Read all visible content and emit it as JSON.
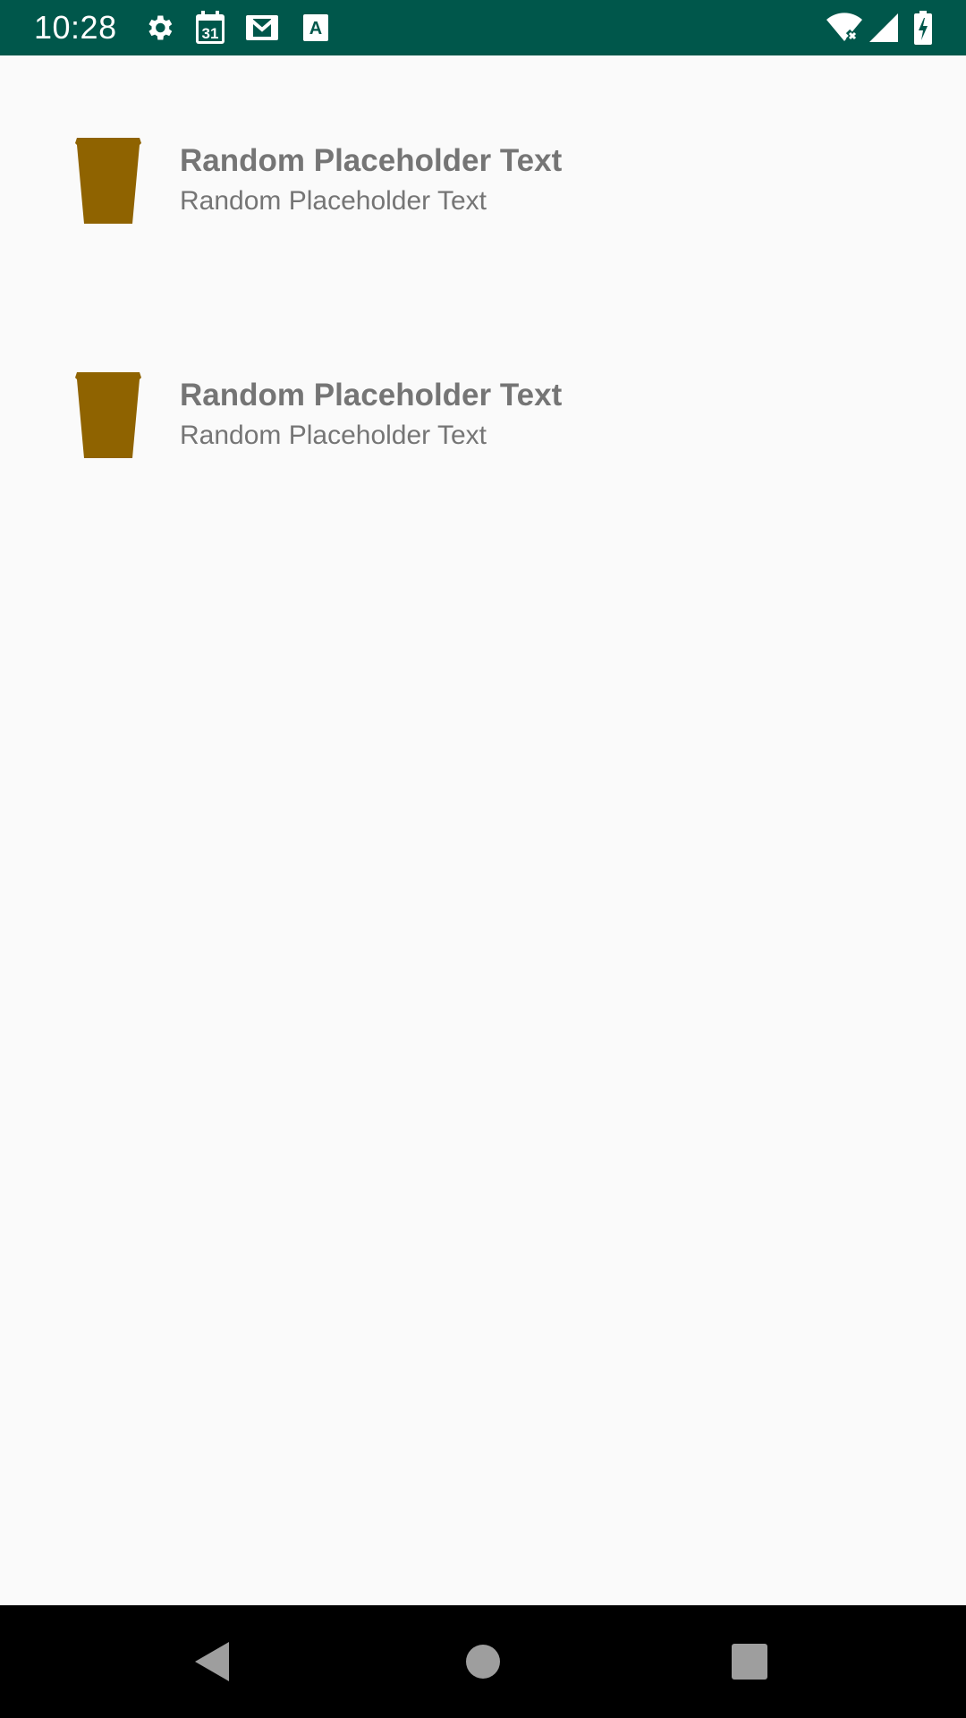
{
  "status_bar": {
    "time": "10:28",
    "background_color": "#00574b",
    "left_icons": [
      "settings-icon",
      "calendar-icon",
      "gmail-icon",
      "translate-icon"
    ],
    "calendar_day": "31",
    "translate_letter": "A",
    "right_icons": [
      "wifi-icon",
      "signal-icon",
      "battery-charging-icon"
    ]
  },
  "list": {
    "items": [
      {
        "icon": "coffee-cup-icon",
        "title": "Random Placeholder Text",
        "subtitle": "Random Placeholder Text"
      },
      {
        "icon": "coffee-cup-icon",
        "title": "Random Placeholder Text",
        "subtitle": "Random Placeholder Text"
      }
    ],
    "icon_color": "#8f6300",
    "text_color": "#757575"
  },
  "nav_bar": {
    "buttons": [
      "back-icon",
      "home-icon",
      "recents-icon"
    ],
    "icon_color": "#9e9e9e"
  }
}
